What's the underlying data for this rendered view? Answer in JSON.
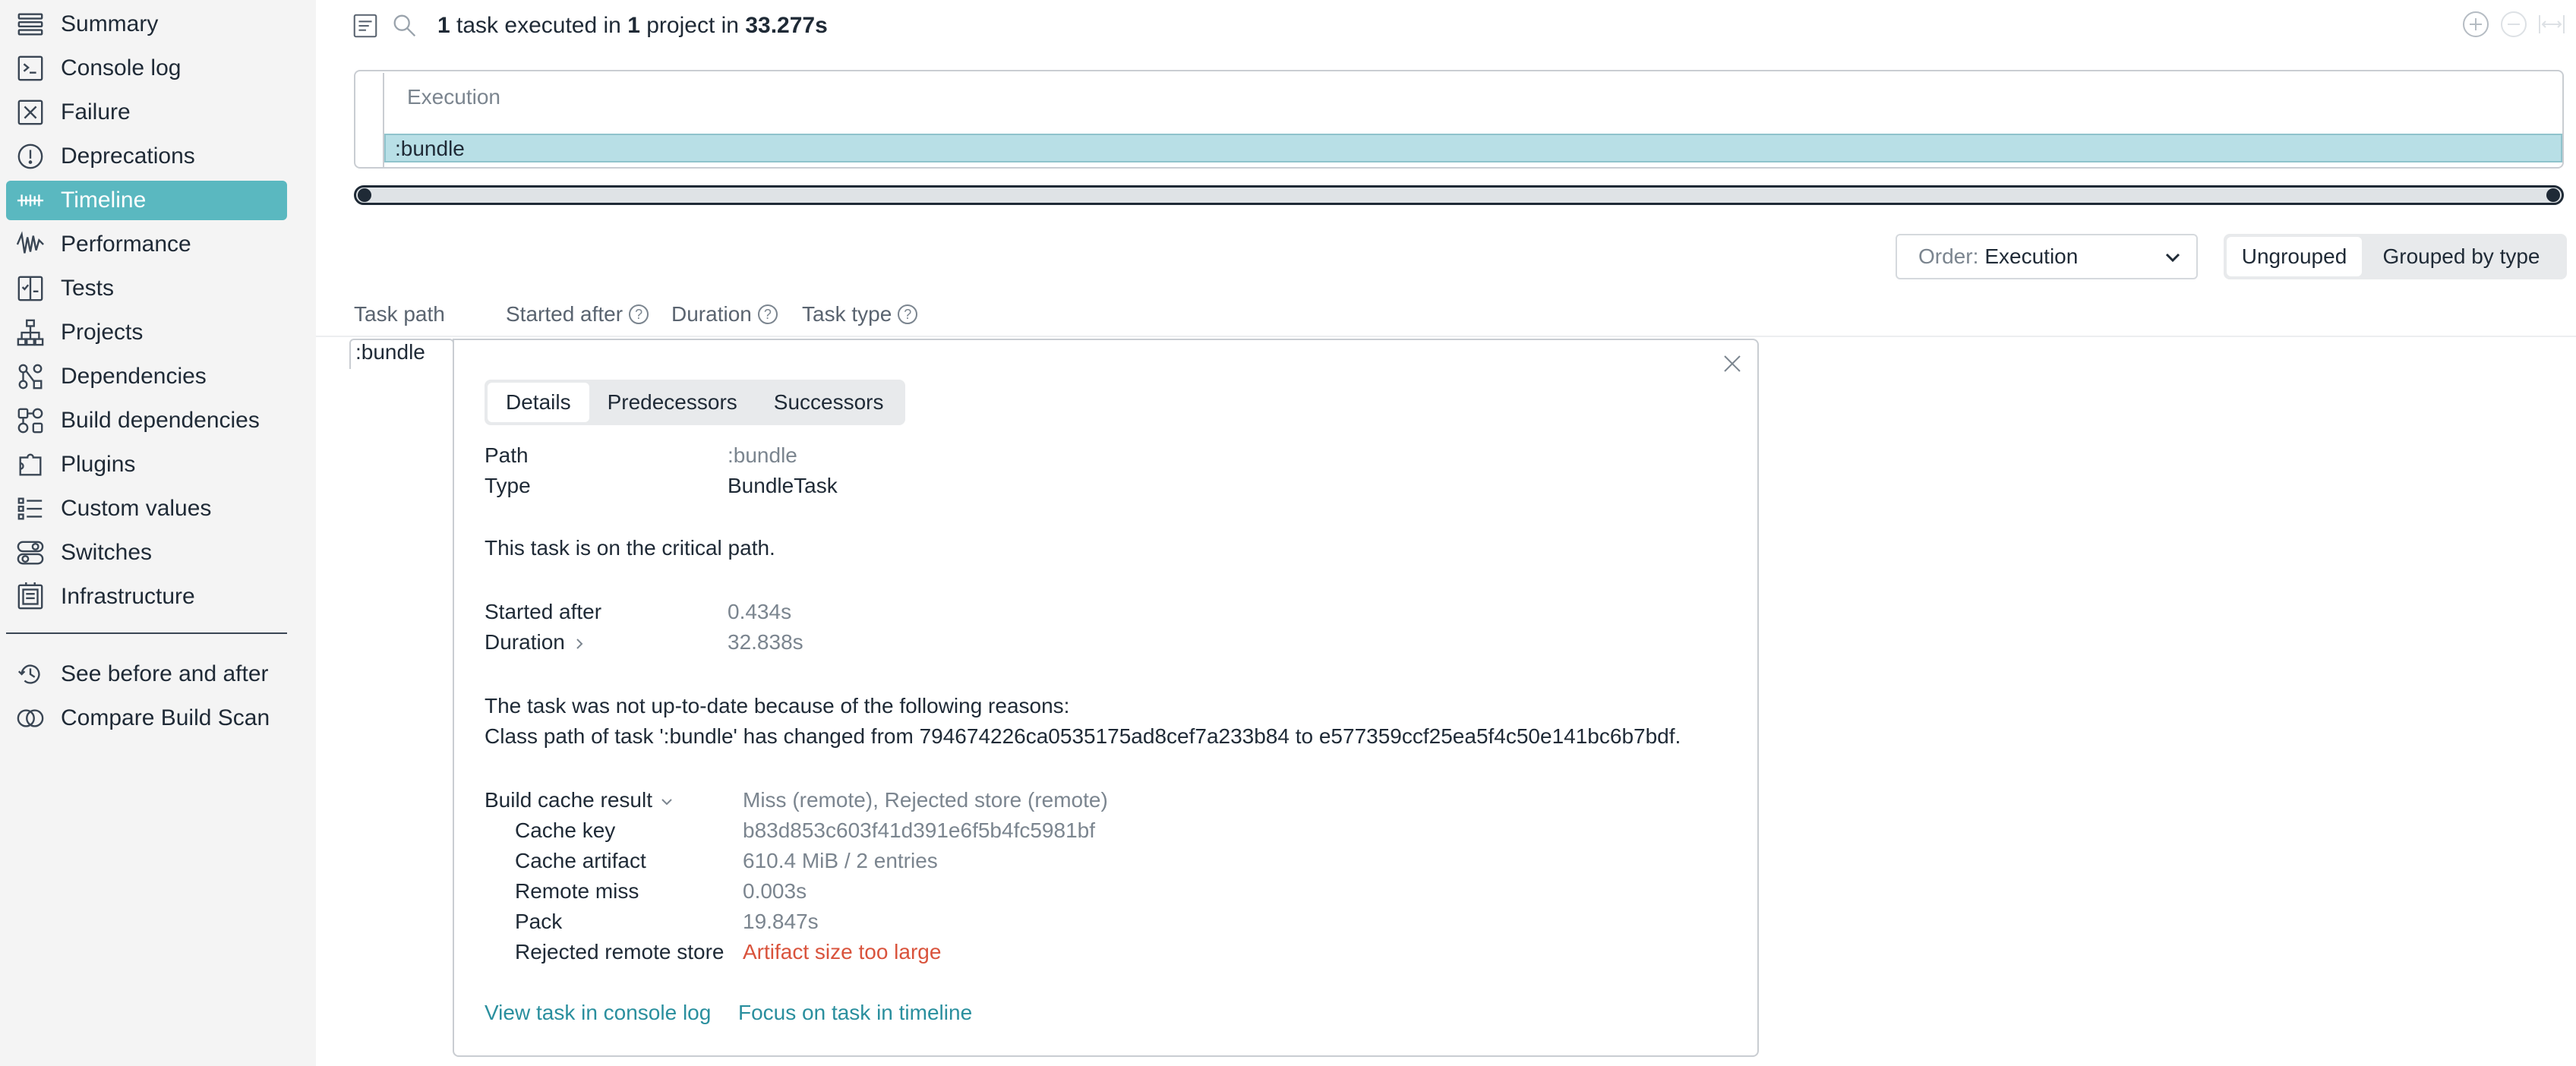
{
  "sidebar": {
    "items": [
      {
        "label": "Summary",
        "icon": "list-icon"
      },
      {
        "label": "Console log",
        "icon": "terminal-icon"
      },
      {
        "label": "Failure",
        "icon": "x-box-icon"
      },
      {
        "label": "Deprecations",
        "icon": "alert-circle-icon"
      },
      {
        "label": "Timeline",
        "icon": "timeline-icon",
        "active": true
      },
      {
        "label": "Performance",
        "icon": "waveform-icon"
      },
      {
        "label": "Tests",
        "icon": "test-icon"
      },
      {
        "label": "Projects",
        "icon": "hierarchy-icon"
      },
      {
        "label": "Dependencies",
        "icon": "dependencies-icon"
      },
      {
        "label": "Build dependencies",
        "icon": "build-dependencies-icon"
      },
      {
        "label": "Plugins",
        "icon": "puzzle-icon"
      },
      {
        "label": "Custom values",
        "icon": "custom-values-icon"
      },
      {
        "label": "Switches",
        "icon": "switches-icon"
      },
      {
        "label": "Infrastructure",
        "icon": "infrastructure-icon"
      }
    ],
    "secondary": [
      {
        "label": "See before and after",
        "icon": "history-icon"
      },
      {
        "label": "Compare Build Scan",
        "icon": "compare-icon"
      }
    ]
  },
  "header": {
    "count": "1",
    "task_word": "task",
    "executed_in": "executed in",
    "project_count": "1",
    "project_word": "project",
    "in_word": "in",
    "duration": "33.277s"
  },
  "timeline": {
    "header": "Execution",
    "bar_label": ":bundle"
  },
  "controls": {
    "order_prefix": "Order:",
    "order_value": "Execution",
    "grouping_options": [
      "Ungrouped",
      "Grouped by type"
    ],
    "grouping_selected": "Ungrouped"
  },
  "columns": {
    "task_path": "Task path",
    "started_after": "Started after",
    "duration": "Duration",
    "task_type": "Task type",
    "help_glyph": "?"
  },
  "task": {
    "path": ":bundle"
  },
  "details": {
    "tabs": [
      "Details",
      "Predecessors",
      "Successors"
    ],
    "path_label": "Path",
    "path_value": ":bundle",
    "type_label": "Type",
    "type_value": "BundleTask",
    "critical_path_note": "This task is on the critical path.",
    "started_after_label": "Started after",
    "started_after_value": "0.434s",
    "duration_label": "Duration",
    "duration_value": "32.838s",
    "not_up_to_date_line1": "The task was not up-to-date because of the following reasons:",
    "not_up_to_date_line2": "Class path of task ':bundle' has changed from 794674226ca0535175ad8cef7a233b84 to e577359ccf25ea5f4c50e141bc6b7bdf.",
    "build_cache_label": "Build cache result",
    "build_cache_value": "Miss (remote), Rejected store (remote)",
    "cache_key_label": "Cache key",
    "cache_key_value": "b83d853c603f41d391e6f5b4fc5981bf",
    "cache_artifact_label": "Cache artifact",
    "cache_artifact_value": "610.4 MiB / 2 entries",
    "remote_miss_label": "Remote miss",
    "remote_miss_value": "0.003s",
    "pack_label": "Pack",
    "pack_value": "19.847s",
    "rejected_label": "Rejected remote store",
    "rejected_value": "Artifact size too large",
    "view_console_link": "View task in console log",
    "focus_timeline_link": "Focus on task in timeline"
  },
  "colors": {
    "accent": "#5ab8c0",
    "link": "#2a8f9e",
    "error": "#d9533c",
    "bar": "#b8dfe6"
  }
}
